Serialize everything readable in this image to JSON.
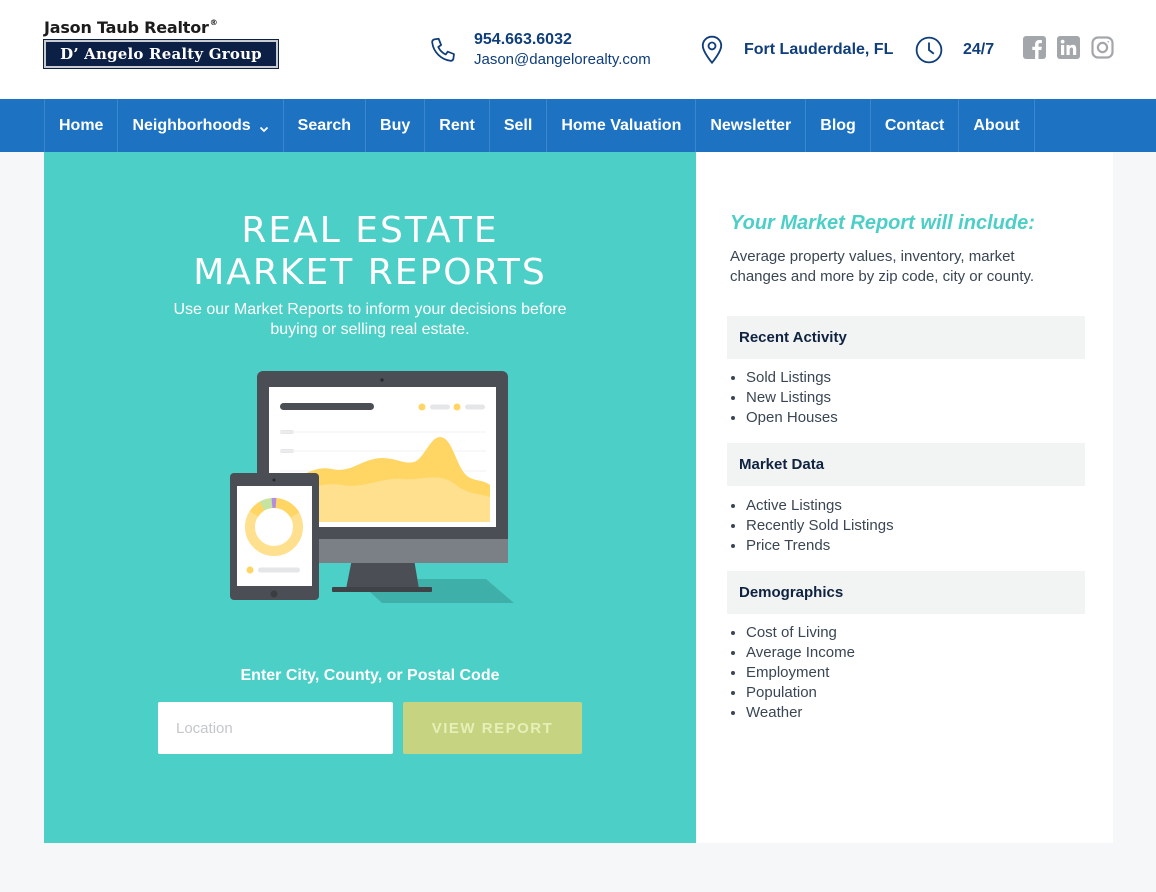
{
  "header": {
    "logo_name": "Jason Taub Realtor",
    "logo_reg": "®",
    "logo_company": "D’ Angelo Realty Group",
    "phone": "954.663.6032",
    "email": "Jason@dangelorealty.com",
    "location": "Fort Lauderdale, FL",
    "hours": "24/7",
    "social_icons": [
      "facebook-icon",
      "linkedin-icon",
      "instagram-icon"
    ]
  },
  "nav": {
    "items": [
      {
        "label": "Home"
      },
      {
        "label": "Neighborhoods",
        "has_dropdown": true
      },
      {
        "label": "Search"
      },
      {
        "label": "Buy"
      },
      {
        "label": "Rent"
      },
      {
        "label": "Sell"
      },
      {
        "label": "Home Valuation"
      },
      {
        "label": "Newsletter"
      },
      {
        "label": "Blog"
      },
      {
        "label": "Contact"
      },
      {
        "label": "About"
      }
    ]
  },
  "hero": {
    "title_line1": "REAL ESTATE",
    "title_line2": "MARKET REPORTS",
    "subtitle": "Use our Market Reports to inform your decisions before buying or selling real estate.",
    "enter_label": "Enter City, County, or Postal Code",
    "input_placeholder": "Location",
    "input_value": "",
    "button_label": "VIEW REPORT"
  },
  "side": {
    "title": "Your Market Report will include:",
    "description": "Average property values, inventory, market changes and more by zip code, city or county.",
    "sections": [
      {
        "heading": "Recent Activity",
        "items": [
          "Sold Listings",
          "New Listings",
          "Open Houses"
        ]
      },
      {
        "heading": "Market Data",
        "items": [
          "Active Listings",
          "Recently Sold Listings",
          "Price Trends"
        ]
      },
      {
        "heading": "Demographics",
        "items": [
          "Cost of Living",
          "Average Income",
          "Employment",
          "Population",
          "Weather"
        ]
      }
    ]
  },
  "colors": {
    "nav_blue": "#1e72c2",
    "teal": "#4bcfc6",
    "button_green": "#c6d380",
    "text_navy": "#0f3e7a"
  }
}
